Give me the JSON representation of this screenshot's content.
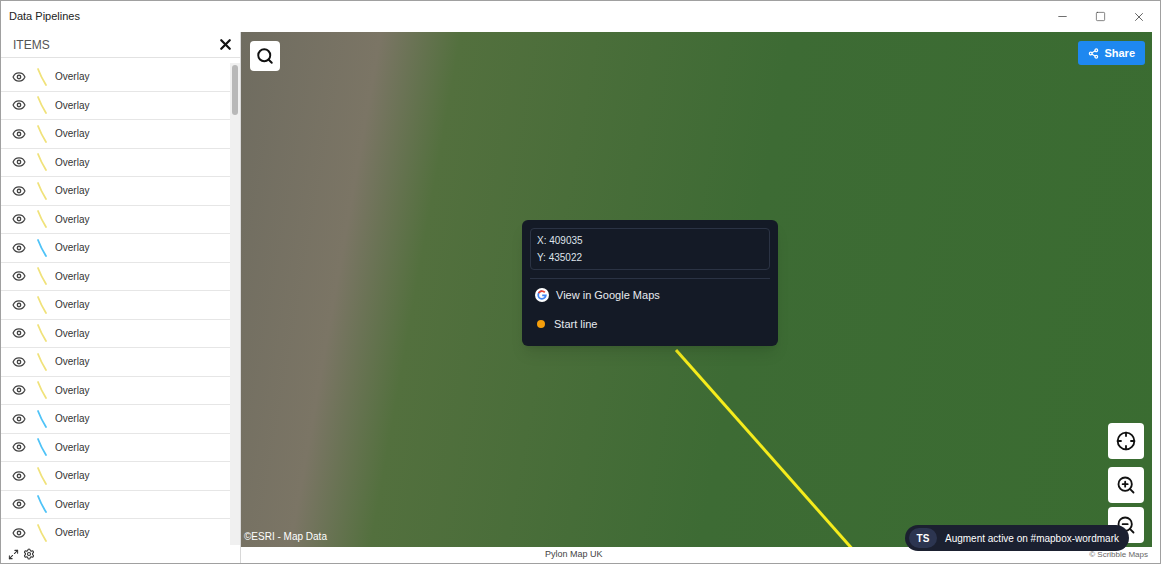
{
  "window": {
    "title": "Data Pipelines"
  },
  "sidebar": {
    "header": "ITEMS",
    "items": [
      {
        "label": "Overlay",
        "visible": true,
        "color": "#f0e27a"
      },
      {
        "label": "Overlay",
        "visible": true,
        "color": "#f0e27a"
      },
      {
        "label": "Overlay",
        "visible": true,
        "color": "#f0e27a"
      },
      {
        "label": "Overlay",
        "visible": true,
        "color": "#f0e27a"
      },
      {
        "label": "Overlay",
        "visible": true,
        "color": "#f0e27a"
      },
      {
        "label": "Overlay",
        "visible": true,
        "color": "#f0e27a"
      },
      {
        "label": "Overlay",
        "visible": true,
        "color": "#4fc3f7"
      },
      {
        "label": "Overlay",
        "visible": true,
        "color": "#f0e27a"
      },
      {
        "label": "Overlay",
        "visible": true,
        "color": "#f0e27a"
      },
      {
        "label": "Overlay",
        "visible": true,
        "color": "#f0e27a"
      },
      {
        "label": "Overlay",
        "visible": true,
        "color": "#f0e27a"
      },
      {
        "label": "Overlay",
        "visible": true,
        "color": "#f0e27a"
      },
      {
        "label": "Overlay",
        "visible": true,
        "color": "#4fc3f7"
      },
      {
        "label": "Overlay",
        "visible": true,
        "color": "#4fc3f7"
      },
      {
        "label": "Overlay",
        "visible": true,
        "color": "#f0e27a"
      },
      {
        "label": "Overlay",
        "visible": true,
        "color": "#4fc3f7"
      },
      {
        "label": "Overlay",
        "visible": true,
        "color": "#f0e27a"
      }
    ]
  },
  "map": {
    "share": "Share",
    "attribution": "©ESRI - Map Data",
    "popup": {
      "x": "X: 409035",
      "y": "Y: 435022",
      "actions": [
        {
          "label": "View in Google Maps",
          "kind": "google"
        },
        {
          "label": "Start line",
          "kind": "dot"
        }
      ]
    },
    "badge": {
      "initials": "TS",
      "text": "Augment active on #mapbox-wordmark"
    }
  },
  "footer": {
    "title": "Pylon Map UK",
    "credit": "© Scribble Maps"
  }
}
